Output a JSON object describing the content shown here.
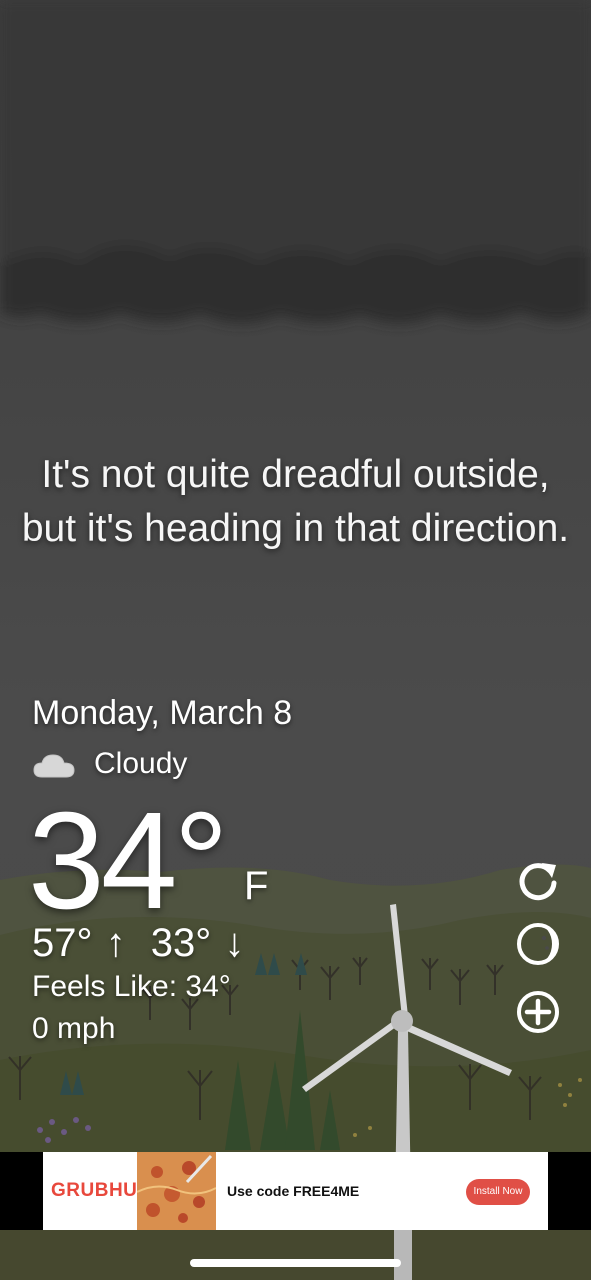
{
  "app": {
    "quote": "It's not quite dreadful outside, but it's heading in that direction."
  },
  "weather": {
    "date": "Monday, March 8",
    "condition": "Cloudy",
    "condition_icon": "cloud-icon",
    "temperature": "34°",
    "unit": "F",
    "high": "57°",
    "low": "33°",
    "feels_like": "Feels Like: 34°",
    "wind": "0 mph"
  },
  "actions": {
    "refresh": "refresh-icon",
    "moon_phase": "moon-icon",
    "add": "add-circle-icon"
  },
  "ad": {
    "brand": "GRUBHUB",
    "message": "Use code FREE4ME",
    "cta": "Install Now",
    "brand_color": "#e8483c"
  },
  "colors": {
    "sky": "#4a4a4a",
    "storm_cloud": "#2f2f2f",
    "hills": "#4d5236"
  }
}
